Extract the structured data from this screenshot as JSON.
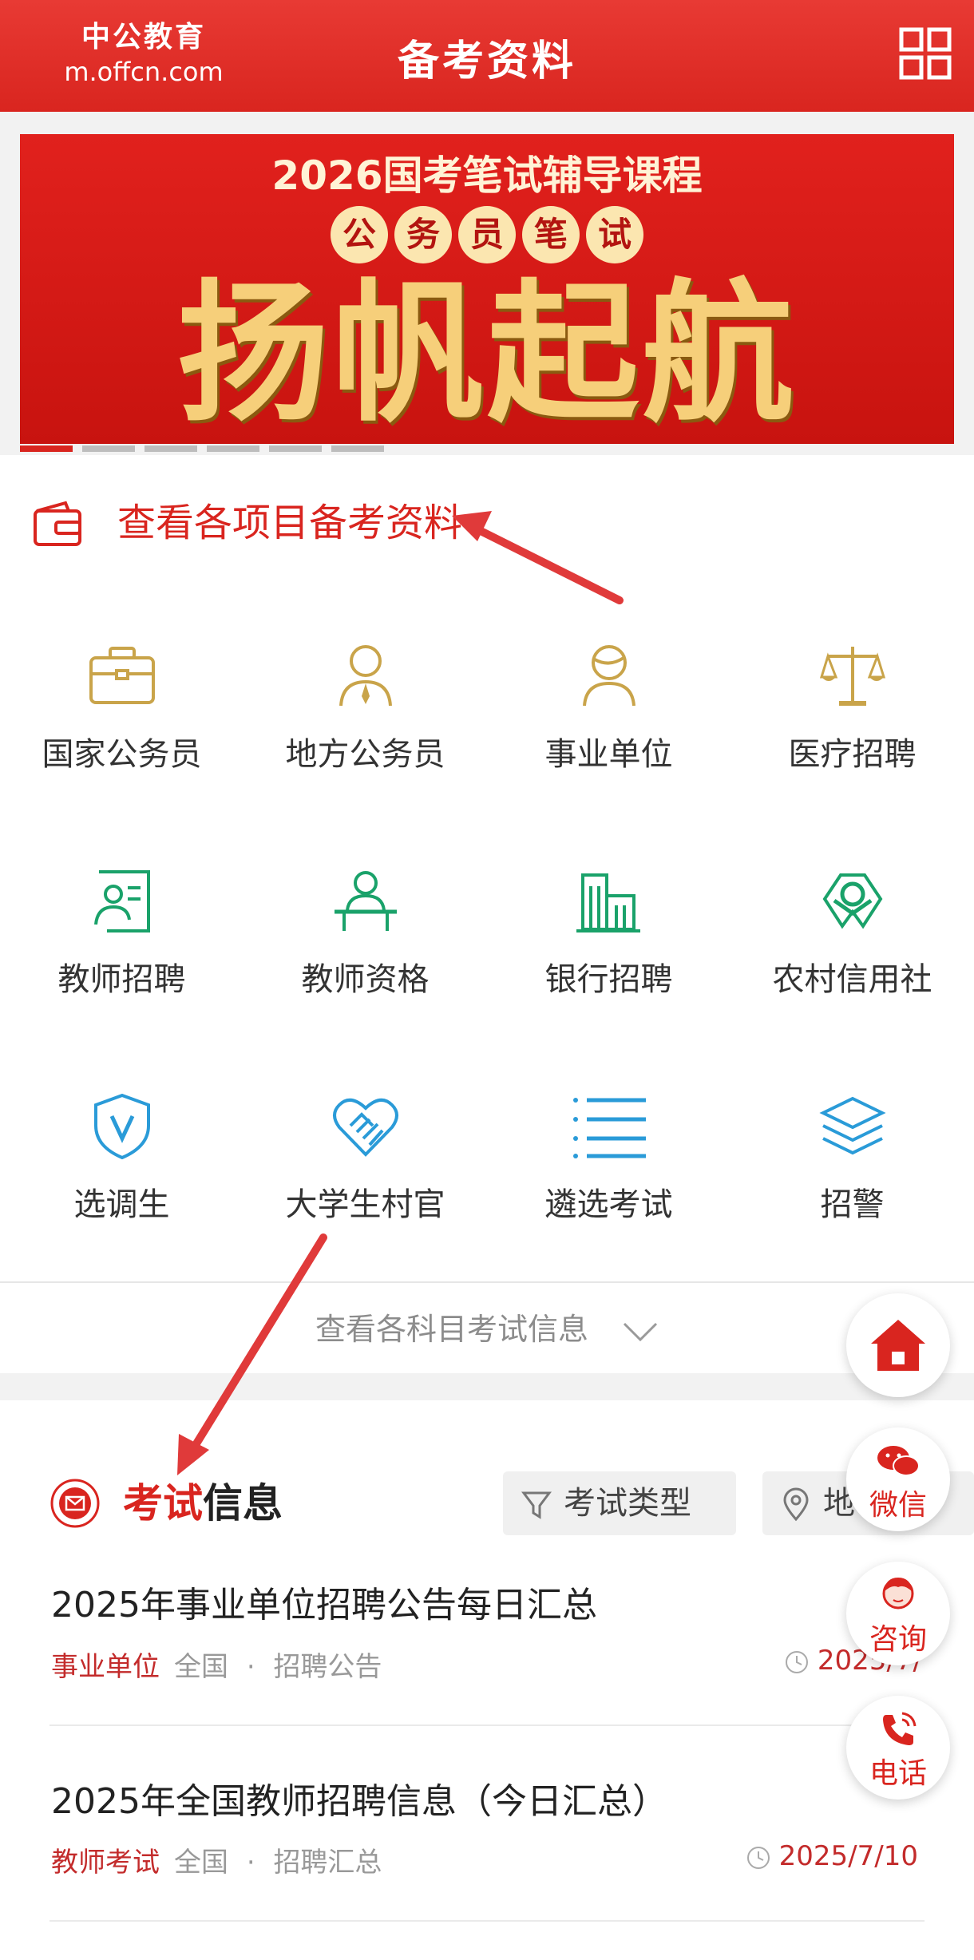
{
  "header": {
    "brand_cn": "中公教育",
    "brand_en": "m.offcn.com",
    "title": "备考资料"
  },
  "banner": {
    "line1": "2026国考笔试辅导课程",
    "badge_chars": [
      "公",
      "务",
      "员",
      "笔",
      "试"
    ],
    "slogan": "扬帆起航",
    "dots_count": 6,
    "active_dot": 0
  },
  "promo": {
    "text": "查看各项目备考资料"
  },
  "categories": [
    {
      "label": "国家公务员",
      "icon": "briefcase-icon",
      "color": "#c9a44a"
    },
    {
      "label": "地方公务员",
      "icon": "person-tie-icon",
      "color": "#c9a44a"
    },
    {
      "label": "事业单位",
      "icon": "person-icon",
      "color": "#c9a44a"
    },
    {
      "label": "医疗招聘",
      "icon": "scale-icon",
      "color": "#c9a44a"
    },
    {
      "label": "教师招聘",
      "icon": "id-card-icon",
      "color": "#1aa26a"
    },
    {
      "label": "教师资格",
      "icon": "teacher-desk-icon",
      "color": "#1aa26a"
    },
    {
      "label": "银行招聘",
      "icon": "bank-building-icon",
      "color": "#1aa26a"
    },
    {
      "label": "农村信用社",
      "icon": "credit-union-logo-icon",
      "color": "#1aa26a"
    },
    {
      "label": "选调生",
      "icon": "shield-v-icon",
      "color": "#2a9bd8"
    },
    {
      "label": "大学生村官",
      "icon": "handshake-heart-icon",
      "color": "#2a9bd8"
    },
    {
      "label": "遴选考试",
      "icon": "list-icon",
      "color": "#2a9bd8"
    },
    {
      "label": "招警",
      "icon": "layers-icon",
      "color": "#2a9bd8"
    }
  ],
  "more": {
    "text": "查看各科目考试信息"
  },
  "news": {
    "title_red": "考试",
    "title_black": "信息",
    "filter_type": "考试类型",
    "filter_region": "地",
    "items": [
      {
        "title": "2025年事业单位招聘公告每日汇总",
        "tag": "事业单位",
        "region": "全国",
        "sep": "·",
        "category": "招聘公告",
        "date": "2025/7/"
      },
      {
        "title": "2025年全国教师招聘信息（今日汇总）",
        "tag": "教师考试",
        "region": "全国",
        "sep": "·",
        "category": "招聘汇总",
        "date": "2025/7/10"
      }
    ]
  },
  "float_buttons": {
    "wechat": "微信",
    "consult": "咨询",
    "phone": "电话"
  },
  "colors": {
    "brand_red": "#d9251f",
    "gold": "#c9a44a",
    "green": "#1aa26a",
    "blue": "#2a9bd8",
    "annotation_arrow": "#e03a3a"
  }
}
